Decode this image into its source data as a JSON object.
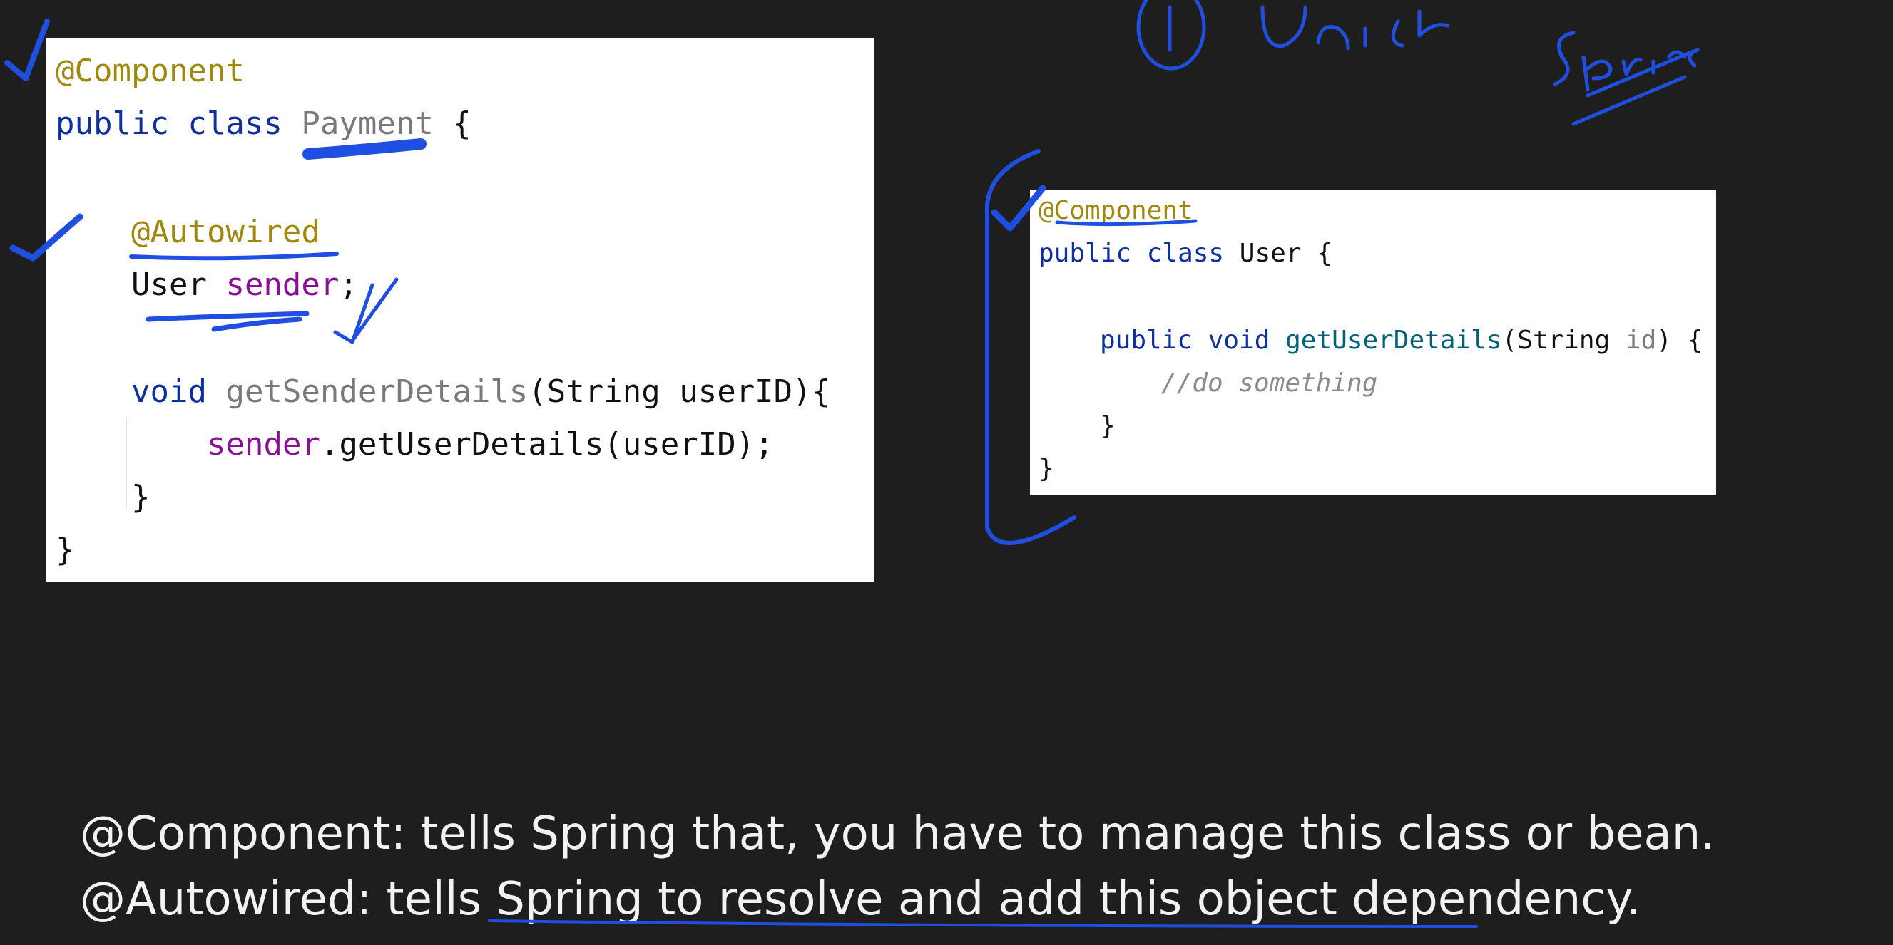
{
  "payment_panel": {
    "line1": "@Component",
    "line2_kw": "public class ",
    "line2_cls": "Payment",
    "line2_end": " {",
    "line3": "@Autowired",
    "line4_type": "User ",
    "line4_field": "sender",
    "line4_end": ";",
    "line5_kw": "void ",
    "line5_mth": "getSenderDetails",
    "line5_rest": "(String userID){",
    "line6_field": "sender",
    "line6_rest": ".getUserDetails(userID);",
    "line7": "}",
    "line8": "}"
  },
  "user_panel": {
    "line1": "@Component",
    "line2_kw": "public class ",
    "line2_cls": "User",
    "line2_end": " {",
    "line3_kw": "public void ",
    "line3_mth": "getUserDetails",
    "line3_open": "(String ",
    "line3_param": "id",
    "line3_close": ") {",
    "line4": "//do something",
    "line5": "}",
    "line6": "}"
  },
  "caption": {
    "line1": "@Component: tells Spring that, you have to manage this class or bean.",
    "line2": "@Autowired: tells Spring to resolve and add this object dependency."
  },
  "colors": {
    "background": "#1e1e1e",
    "annotation": "#9e880d",
    "keyword": "#0f31a0",
    "field": "#871094",
    "ink": "#1f4fe0"
  }
}
